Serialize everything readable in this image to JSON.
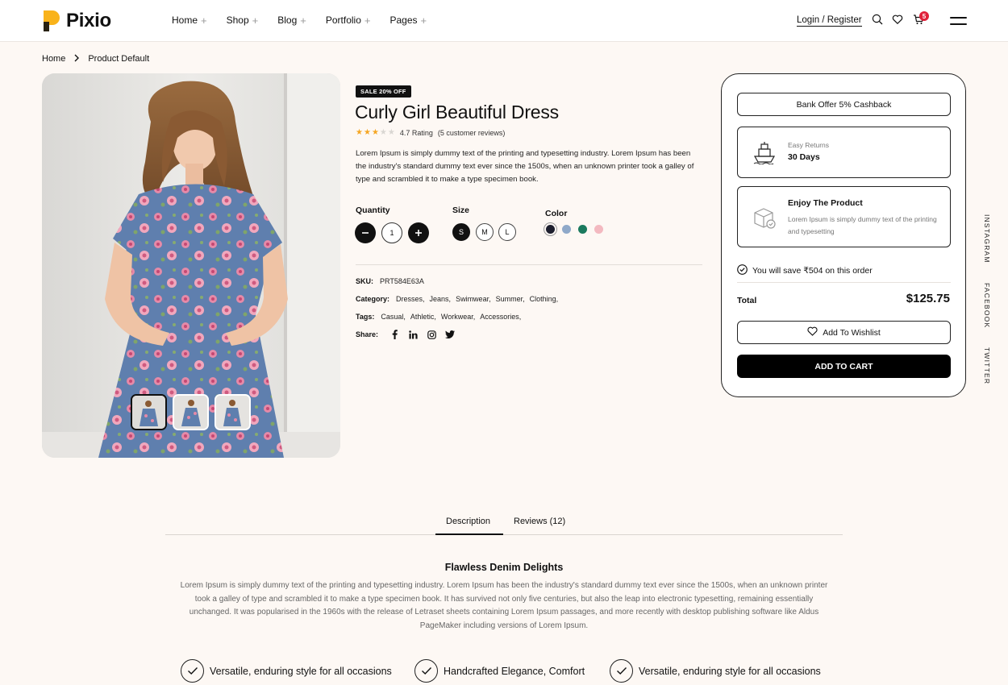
{
  "brand": {
    "name": "Pixio",
    "accent": "#f9b31b"
  },
  "nav": [
    {
      "label": "Home"
    },
    {
      "label": "Shop"
    },
    {
      "label": "Blog"
    },
    {
      "label": "Portfolio"
    },
    {
      "label": "Pages"
    }
  ],
  "header": {
    "login_label": "Login / Register",
    "cart_count": "5",
    "icons": [
      "search-icon",
      "heart-icon",
      "cart-icon",
      "menu-icon"
    ]
  },
  "breadcrumb": {
    "home": "Home",
    "current": "Product Default"
  },
  "product": {
    "badge": "SALE 20% OFF",
    "title": "Curly Girl Beautiful Dress",
    "rating_value": 3,
    "rating_max": 5,
    "rating_text": "4.7 Rating",
    "reviews_text": "(5 customer reviews)",
    "description": "Lorem Ipsum is simply dummy text of the printing and typesetting industry. Lorem Ipsum has been the industry's standard dummy text ever since the 1500s, when an unknown printer took a galley of type and scrambled it to make a type specimen book.",
    "quantity_label": "Quantity",
    "quantity": "1",
    "size_label": "Size",
    "sizes": [
      "S",
      "M",
      "L"
    ],
    "selected_size": "S",
    "color_label": "Color",
    "colors": [
      "#1d1f2e",
      "#8fa9c9",
      "#1b7a5e",
      "#f3b9c0"
    ],
    "sku_label": "SKU:",
    "sku": "PRT584E63A",
    "category_label": "Category:",
    "categories": [
      "Dresses,",
      "Jeans,",
      "Swimwear,",
      "Summer,",
      "Clothing,"
    ],
    "tags_label": "Tags:",
    "tags": [
      "Casual,",
      "Athletic,",
      "Workwear,",
      "Accessories,"
    ],
    "share_label": "Share:"
  },
  "panel": {
    "bank_offer": "Bank Offer 5% Cashback",
    "returns_small": "Easy Returns",
    "returns_bold": "30 Days",
    "enjoy_title": "Enjoy The Product",
    "enjoy_text": "Lorem Ipsum is simply dummy text of the printing and typesetting",
    "save_text": "You will save ₹504 on this order",
    "total_label": "Total",
    "total_value": "$125.75",
    "wishlist_label": "Add To Wishlist",
    "cart_label": "ADD TO CART"
  },
  "socials": [
    "INSTAGRAM",
    "FACEBOOK",
    "TWITTER"
  ],
  "tabs": [
    {
      "label": "Description",
      "active": true
    },
    {
      "label": "Reviews (12)",
      "active": false
    }
  ],
  "section": {
    "title": "Flawless Denim Delights",
    "text": "Lorem Ipsum is simply dummy text of the printing and typesetting industry. Lorem Ipsum has been the industry's standard dummy text ever since the 1500s, when an unknown printer took a galley of type and scrambled it to make a type specimen book. It has survived not only five centuries, but also the leap into electronic typesetting, remaining essentially unchanged. It was popularised in the 1960s with the release of Letraset sheets containing Lorem Ipsum passages, and more recently with desktop publishing software like Aldus PageMaker including versions of Lorem Ipsum."
  },
  "features": [
    "Versatile, enduring style for all occasions",
    "Handcrafted Elegance, Comfort",
    "Versatile, enduring style for all occasions"
  ]
}
